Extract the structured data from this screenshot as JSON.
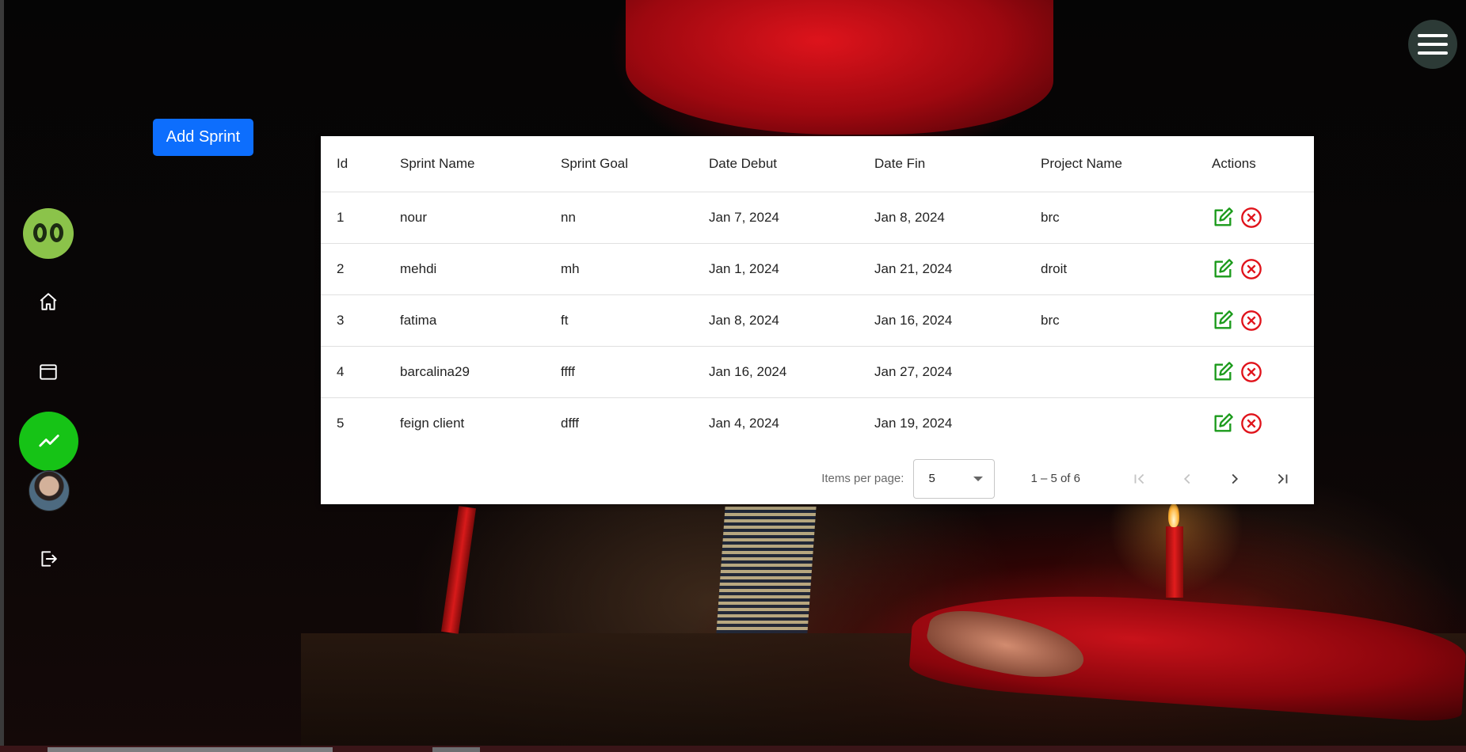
{
  "header": {
    "menu_icon": "hamburger-menu-icon"
  },
  "toolbar": {
    "add_sprint_label": "Add Sprint"
  },
  "sidebar": {
    "logo": "brand-logo",
    "items": [
      {
        "icon": "home-icon"
      },
      {
        "icon": "window-icon"
      },
      {
        "icon": "trending-up-icon",
        "active": true
      },
      {
        "icon": "avatar"
      },
      {
        "icon": "logout-icon"
      }
    ],
    "active_color": "#16c316",
    "logo_color": "#8bc34a"
  },
  "table": {
    "columns": [
      "Id",
      "Sprint Name",
      "Sprint Goal",
      "Date Debut",
      "Date Fin",
      "Project Name",
      "Actions"
    ],
    "rows": [
      {
        "id": "1",
        "name": "nour",
        "goal": "nn",
        "debut": "Jan 7, 2024",
        "fin": "Jan 8, 2024",
        "project": "brc"
      },
      {
        "id": "2",
        "name": "mehdi",
        "goal": "mh",
        "debut": "Jan 1, 2024",
        "fin": "Jan 21, 2024",
        "project": "droit"
      },
      {
        "id": "3",
        "name": "fatima",
        "goal": "ft",
        "debut": "Jan 8, 2024",
        "fin": "Jan 16, 2024",
        "project": "brc"
      },
      {
        "id": "4",
        "name": "barcalina29",
        "goal": "ffff",
        "debut": "Jan 16, 2024",
        "fin": "Jan 27, 2024",
        "project": ""
      },
      {
        "id": "5",
        "name": "feign client",
        "goal": "dfff",
        "debut": "Jan 4, 2024",
        "fin": "Jan 19, 2024",
        "project": ""
      }
    ],
    "edit_color": "#1a9a1a",
    "delete_color": "#e0131b"
  },
  "paginator": {
    "items_per_page_label": "Items per page:",
    "page_size": "5",
    "range_label": "1 – 5 of 6"
  },
  "accent_color": "#0d6efd"
}
